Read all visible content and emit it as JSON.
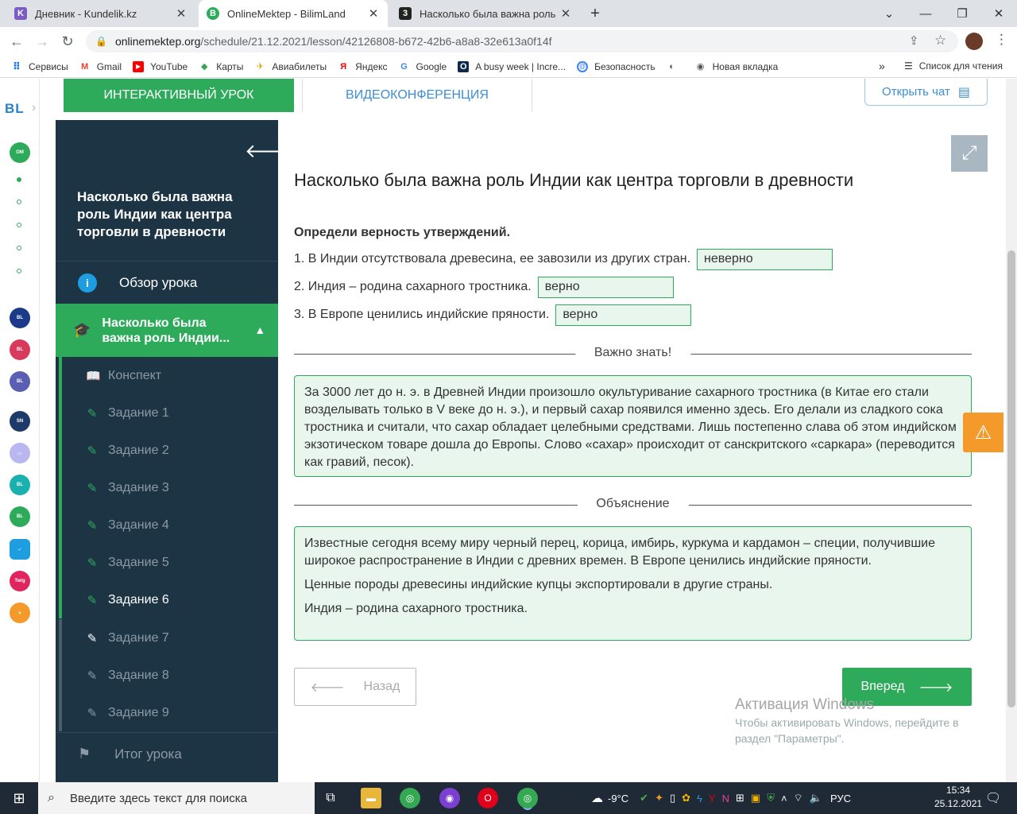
{
  "browser": {
    "tabs": [
      {
        "title": "Дневник - Kundelik.kz",
        "favicon": "K"
      },
      {
        "title": "OnlineMektep - BilimLand",
        "favicon": "B"
      },
      {
        "title": "Насколько была важна роль Инд",
        "favicon": "3"
      }
    ],
    "new_tab": "+",
    "url_host": "onlinemektep.org",
    "url_path": "/schedule/21.12.2021/lesson/42126808-b672-42b6-a8a8-32e613a0f14f",
    "bookmarks": [
      "Сервисы",
      "Gmail",
      "YouTube",
      "Карты",
      "Авиабилеты",
      "Яндекс",
      "Google",
      "A busy week | Incre...",
      "Безопасность",
      "",
      "Новая вкладка"
    ],
    "reading_list": "Список для чтения",
    "more": "»"
  },
  "rail": {
    "logo": "BL"
  },
  "page_tabs": {
    "interactive": "ИНТЕРАКТИВНЫЙ УРОК",
    "video": "ВИДЕОКОНФЕРЕНЦИЯ",
    "open_chat": "Открыть чат"
  },
  "sidebar": {
    "title": "Насколько была важна роль Индии как центра торговли в древности",
    "overview": "Обзор урока",
    "current_section": "Насколько была важна роль Индии...",
    "items": [
      {
        "label": "Конспект"
      },
      {
        "label": "Задание 1"
      },
      {
        "label": "Задание 2"
      },
      {
        "label": "Задание 3"
      },
      {
        "label": "Задание 4"
      },
      {
        "label": "Задание 5"
      },
      {
        "label": "Задание 6"
      },
      {
        "label": "Задание 7"
      },
      {
        "label": "Задание 8"
      },
      {
        "label": "Задание 9"
      }
    ],
    "final": "Итог урока"
  },
  "content": {
    "title": "Насколько была важна роль Индии как центра торговли в древности",
    "instruction": "Определи верность утверждений.",
    "statements": [
      {
        "text": "1. В Индии отсутствовала древесина, ее завозили из других стран.",
        "answer": "неверно"
      },
      {
        "text": "2. Индия – родина сахарного тростника.",
        "answer": "верно"
      },
      {
        "text": "3. В Европе ценились индийские пряности.",
        "answer": "верно"
      }
    ],
    "important_label": "Важно знать!",
    "important_text": "За 3000 лет до н. э. в Древней Индии произошло окультуривание сахарного тростника (в Китае его стали возделывать только в V веке до н. э.), и первый сахар появился именно здесь. Его делали из сладкого сока тростника и считали, что сахар обладает целебными средствами. Лишь постепенно слава об этом индийском экзотическом товаре дошла до Европы. Слово «сахар» происходит от санскритского «саркара» (переводится как гравий, песок).",
    "explanation_label": "Объяснение",
    "explanation": [
      "Известные сегодня всему миру черный перец, корица, имбирь, куркума и кардамон – специи, получившие широкое распространение в Индии с древних времен. В Европе ценились индийские пряности.",
      "Ценные породы древесины индийские купцы экспортировали в другие страны.",
      "Индия – родина сахарного тростника."
    ],
    "back": "Назад",
    "next": "Вперед"
  },
  "windows_activation": {
    "title": "Активация Windows",
    "line1": "Чтобы активировать Windows, перейдите в",
    "line2": "раздел \"Параметры\"."
  },
  "taskbar": {
    "search_placeholder": "Введите здесь текст для поиска",
    "weather": "-9°C",
    "lang": "РУС",
    "time": "15:34",
    "date": "25.12.2021"
  },
  "colors": {
    "accent": "#2eab5a",
    "sidebar": "#1d3445",
    "link": "#3d8fd1",
    "warning": "#f39a2a"
  }
}
